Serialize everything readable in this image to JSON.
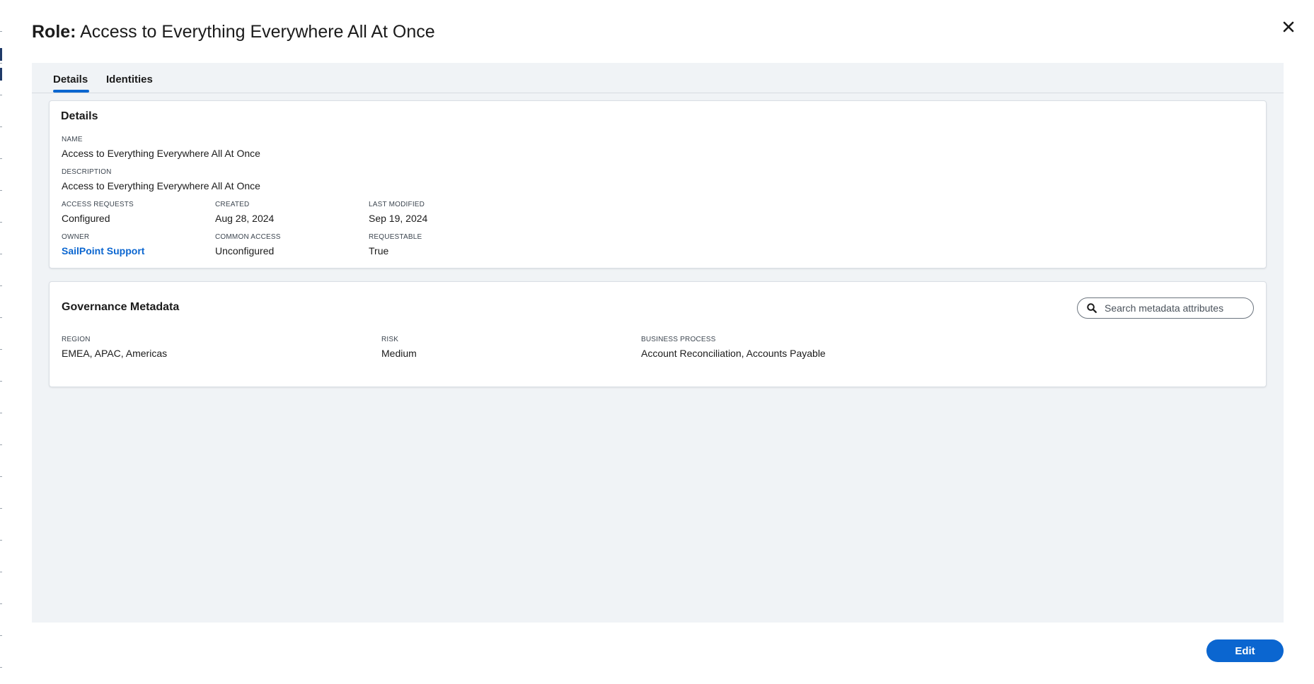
{
  "modal": {
    "title_prefix": "Role:",
    "title": "Access to Everything Everywhere All At Once",
    "close_icon": "close-icon"
  },
  "tabs": [
    {
      "label": "Details",
      "active": true
    },
    {
      "label": "Identities",
      "active": false
    }
  ],
  "details": {
    "heading": "Details",
    "name_label": "NAME",
    "name_value": "Access to Everything Everywhere All At Once",
    "description_label": "DESCRIPTION",
    "description_value": "Access to Everything Everywhere All At Once",
    "access_requests_label": "ACCESS REQUESTS",
    "access_requests_value": "Configured",
    "created_label": "CREATED",
    "created_value": "Aug 28, 2024",
    "last_modified_label": "LAST MODIFIED",
    "last_modified_value": "Sep 19, 2024",
    "owner_label": "OWNER",
    "owner_value": "SailPoint Support",
    "common_access_label": "COMMON ACCESS",
    "common_access_value": "Unconfigured",
    "requestable_label": "REQUESTABLE",
    "requestable_value": "True"
  },
  "governance": {
    "heading": "Governance Metadata",
    "search_placeholder": "Search metadata attributes",
    "search_icon": "search-icon",
    "region_label": "REGION",
    "region_value": "EMEA, APAC, Americas",
    "risk_label": "RISK",
    "risk_value": "Medium",
    "business_process_label": "BUSINESS PROCESS",
    "business_process_value": "Account Reconciliation, Accounts Payable"
  },
  "footer": {
    "edit_label": "Edit"
  },
  "colors": {
    "accent": "#0b66d0",
    "content_bg": "#f0f3f6",
    "card_bg": "#ffffff"
  }
}
